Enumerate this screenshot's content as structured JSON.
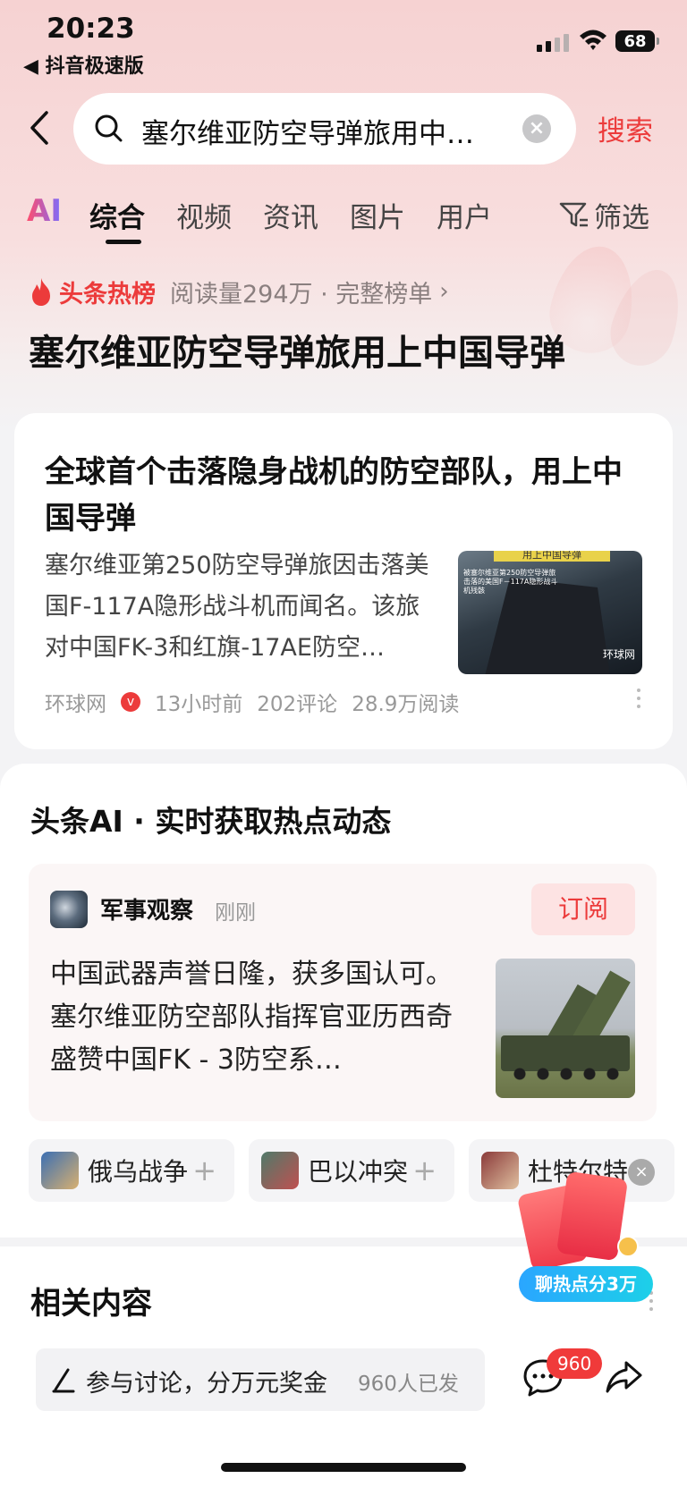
{
  "status_bar": {
    "time": "20:23",
    "back_app": "◀ 抖音极速版",
    "battery": "68"
  },
  "search": {
    "query": "塞尔维亚防空导弹旅用中…",
    "clear_icon": "clear-icon",
    "button": "搜索"
  },
  "tabs": {
    "ai": "AI",
    "items": [
      "综合",
      "视频",
      "资讯",
      "图片",
      "用户"
    ],
    "filter": "筛选",
    "active": "综合"
  },
  "hot": {
    "label": "头条热榜",
    "meta": "阅读量294万 · 完整榜单",
    "title": "塞尔维亚防空导弹旅用上中国导弹"
  },
  "article": {
    "title": "全球首个击落隐身战机的防空部队，用上中国导弹",
    "body": "塞尔维亚第250防空导弹旅因击落美国F-117A隐形战斗机而闻名。该旅对中国FK-3和红旗-17AE防空…",
    "thumb_banner": "用上中国导弹",
    "thumb_caption": "被塞尔维亚第250防空导弹旅击落的美国F－117A隐形战斗机残骸",
    "thumb_logo": "环球网",
    "source": "环球网",
    "time": "13小时前",
    "comments": "202评论",
    "reads": "28.9万阅读"
  },
  "ai_section": {
    "heading": "头条AI · 实时获取热点动态",
    "source_name": "军事观察",
    "source_time": "刚刚",
    "subscribe": "订阅",
    "body": "中国武器声誉日隆，获多国认可。塞尔维亚防空部队指挥官亚历西奇盛赞中国FK - 3防空系…"
  },
  "chips": [
    {
      "label": "俄乌战争",
      "avatar_color": "#3b6fb3"
    },
    {
      "label": "巴以冲突",
      "avatar_color": "#4f7a6a"
    },
    {
      "label": "杜特尔特",
      "avatar_color": "#8a3a3a"
    }
  ],
  "related": {
    "title": "相关内容"
  },
  "bottom": {
    "comment_prompt": "参与讨论，分万元奖金",
    "comment_count": "960人已发",
    "badge": "960"
  },
  "promo": {
    "label": "聊热点分3万",
    "close": "×"
  },
  "colors": {
    "accent": "#ec3b3b",
    "promo_blue": "#2aa6ff"
  }
}
